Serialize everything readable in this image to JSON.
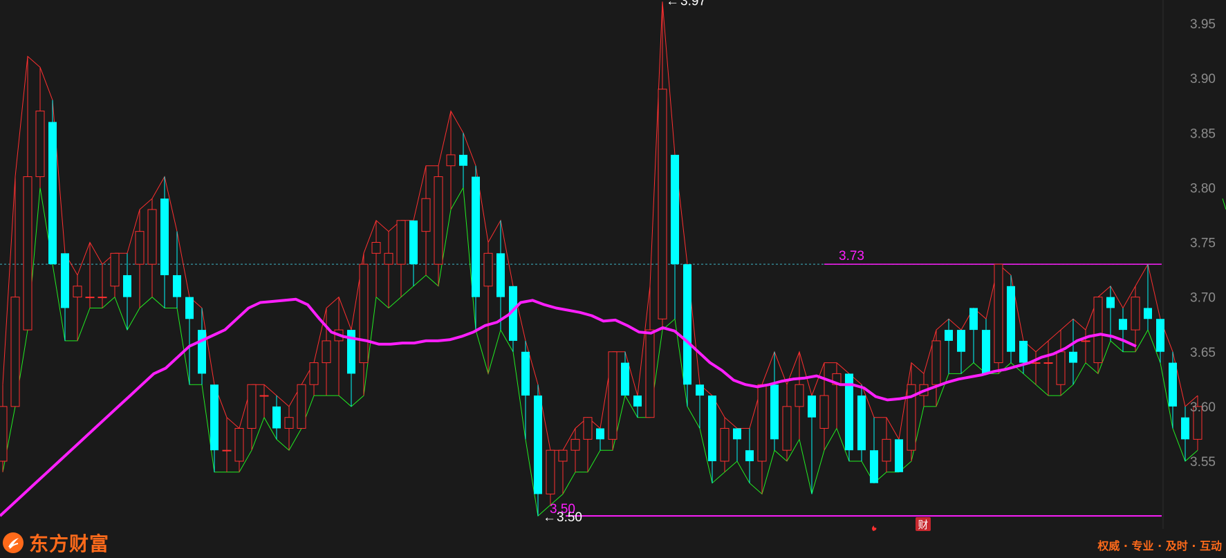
{
  "brand": {
    "name": "东方财富",
    "slogan": "权威 · 专业 · 及时 · 互动"
  },
  "markers": {
    "event_badge": "财",
    "event_icon": "flame-icon"
  },
  "colors": {
    "background": "#1a1a1a",
    "up": "#ff3030",
    "down": "#00ffff",
    "ma": "#ff1fff",
    "lower_band": "#22ee22",
    "reference_line": "#ff1fff",
    "brand": "#ff6a1a",
    "axis_text": "#8c8c8c"
  },
  "chart_data": {
    "type": "candlestick",
    "yaxis": {
      "ticks": [
        "3.95",
        "3.90",
        "3.85",
        "3.80",
        "3.75",
        "3.70",
        "3.65",
        "3.60",
        "3.55"
      ],
      "tick_values": [
        3.95,
        3.9,
        3.85,
        3.8,
        3.75,
        3.7,
        3.65,
        3.6,
        3.55
      ],
      "range": [
        3.495,
        3.985
      ],
      "position": "right"
    },
    "annotations": {
      "high_label": "3.97",
      "high_value": 3.97,
      "low_label": "3.50",
      "low_value": 3.5,
      "level_high_label": "3.73",
      "level_high_value": 3.73,
      "level_low_label": "3.50"
    },
    "candles": [
      [
        3.55,
        3.6,
        3.54,
        3.62
      ],
      [
        3.6,
        3.7,
        3.6,
        3.81
      ],
      [
        3.67,
        3.81,
        3.67,
        3.92
      ],
      [
        3.81,
        3.87,
        3.8,
        3.91
      ],
      [
        3.86,
        3.73,
        3.73,
        3.88
      ],
      [
        3.74,
        3.69,
        3.66,
        3.74
      ],
      [
        3.7,
        3.71,
        3.66,
        3.72
      ],
      [
        3.7,
        3.7,
        3.69,
        3.75
      ],
      [
        3.7,
        3.7,
        3.69,
        3.73
      ],
      [
        3.71,
        3.74,
        3.7,
        3.74
      ],
      [
        3.72,
        3.7,
        3.67,
        3.74
      ],
      [
        3.73,
        3.76,
        3.69,
        3.78
      ],
      [
        3.73,
        3.78,
        3.7,
        3.79
      ],
      [
        3.79,
        3.72,
        3.69,
        3.81
      ],
      [
        3.72,
        3.7,
        3.69,
        3.76
      ],
      [
        3.7,
        3.68,
        3.62,
        3.7
      ],
      [
        3.67,
        3.63,
        3.62,
        3.69
      ],
      [
        3.62,
        3.56,
        3.54,
        3.62
      ],
      [
        3.56,
        3.56,
        3.54,
        3.59
      ],
      [
        3.55,
        3.58,
        3.54,
        3.58
      ],
      [
        3.58,
        3.62,
        3.56,
        3.62
      ],
      [
        3.61,
        3.61,
        3.59,
        3.62
      ],
      [
        3.6,
        3.58,
        3.57,
        3.61
      ],
      [
        3.58,
        3.59,
        3.56,
        3.6
      ],
      [
        3.58,
        3.62,
        3.58,
        3.62
      ],
      [
        3.62,
        3.64,
        3.61,
        3.64
      ],
      [
        3.64,
        3.66,
        3.61,
        3.69
      ],
      [
        3.66,
        3.67,
        3.61,
        3.7
      ],
      [
        3.67,
        3.63,
        3.6,
        3.67
      ],
      [
        3.64,
        3.73,
        3.61,
        3.74
      ],
      [
        3.74,
        3.75,
        3.7,
        3.77
      ],
      [
        3.73,
        3.74,
        3.69,
        3.76
      ],
      [
        3.73,
        3.77,
        3.7,
        3.77
      ],
      [
        3.77,
        3.73,
        3.71,
        3.77
      ],
      [
        3.76,
        3.79,
        3.72,
        3.82
      ],
      [
        3.73,
        3.81,
        3.71,
        3.82
      ],
      [
        3.82,
        3.83,
        3.78,
        3.87
      ],
      [
        3.83,
        3.82,
        3.8,
        3.85
      ],
      [
        3.81,
        3.7,
        3.67,
        3.82
      ],
      [
        3.71,
        3.74,
        3.63,
        3.75
      ],
      [
        3.74,
        3.7,
        3.67,
        3.77
      ],
      [
        3.71,
        3.66,
        3.65,
        3.71
      ],
      [
        3.65,
        3.61,
        3.57,
        3.66
      ],
      [
        3.61,
        3.52,
        3.5,
        3.62
      ],
      [
        3.52,
        3.56,
        3.51,
        3.56
      ],
      [
        3.55,
        3.56,
        3.52,
        3.56
      ],
      [
        3.56,
        3.57,
        3.54,
        3.58
      ],
      [
        3.57,
        3.59,
        3.54,
        3.59
      ],
      [
        3.58,
        3.57,
        3.56,
        3.58
      ],
      [
        3.57,
        3.65,
        3.56,
        3.65
      ],
      [
        3.64,
        3.61,
        3.61,
        3.65
      ],
      [
        3.61,
        3.6,
        3.59,
        3.61
      ],
      [
        3.59,
        3.67,
        3.59,
        3.71
      ],
      [
        3.68,
        3.89,
        3.67,
        3.97
      ],
      [
        3.83,
        3.73,
        3.68,
        3.83
      ],
      [
        3.73,
        3.62,
        3.6,
        3.73
      ],
      [
        3.62,
        3.61,
        3.58,
        3.62
      ],
      [
        3.61,
        3.55,
        3.53,
        3.61
      ],
      [
        3.55,
        3.58,
        3.54,
        3.59
      ],
      [
        3.58,
        3.57,
        3.55,
        3.58
      ],
      [
        3.56,
        3.55,
        3.53,
        3.58
      ],
      [
        3.55,
        3.62,
        3.52,
        3.62
      ],
      [
        3.62,
        3.57,
        3.56,
        3.65
      ],
      [
        3.56,
        3.6,
        3.55,
        3.62
      ],
      [
        3.6,
        3.62,
        3.57,
        3.65
      ],
      [
        3.61,
        3.59,
        3.52,
        3.61
      ],
      [
        3.58,
        3.61,
        3.56,
        3.64
      ],
      [
        3.62,
        3.63,
        3.58,
        3.64
      ],
      [
        3.63,
        3.56,
        3.55,
        3.63
      ],
      [
        3.61,
        3.56,
        3.55,
        3.62
      ],
      [
        3.56,
        3.53,
        3.53,
        3.59
      ],
      [
        3.55,
        3.57,
        3.54,
        3.59
      ],
      [
        3.57,
        3.54,
        3.54,
        3.57
      ],
      [
        3.56,
        3.62,
        3.55,
        3.64
      ],
      [
        3.61,
        3.62,
        3.6,
        3.63
      ],
      [
        3.62,
        3.66,
        3.6,
        3.67
      ],
      [
        3.67,
        3.66,
        3.63,
        3.68
      ],
      [
        3.67,
        3.65,
        3.63,
        3.67
      ],
      [
        3.69,
        3.67,
        3.64,
        3.69
      ],
      [
        3.67,
        3.63,
        3.63,
        3.68
      ],
      [
        3.64,
        3.73,
        3.63,
        3.73
      ],
      [
        3.71,
        3.65,
        3.64,
        3.72
      ],
      [
        3.66,
        3.64,
        3.63,
        3.66
      ],
      [
        3.64,
        3.64,
        3.62,
        3.65
      ],
      [
        3.64,
        3.64,
        3.61,
        3.66
      ],
      [
        3.62,
        3.65,
        3.61,
        3.67
      ],
      [
        3.65,
        3.64,
        3.62,
        3.68
      ],
      [
        3.66,
        3.66,
        3.64,
        3.67
      ],
      [
        3.64,
        3.7,
        3.63,
        3.7
      ],
      [
        3.7,
        3.69,
        3.66,
        3.71
      ],
      [
        3.68,
        3.67,
        3.65,
        3.69
      ],
      [
        3.67,
        3.7,
        3.65,
        3.71
      ],
      [
        3.69,
        3.68,
        3.67,
        3.73
      ],
      [
        3.68,
        3.65,
        3.64,
        3.68
      ],
      [
        3.64,
        3.6,
        3.58,
        3.65
      ],
      [
        3.59,
        3.57,
        3.55,
        3.6
      ],
      [
        3.57,
        3.6,
        3.56,
        3.61
      ]
    ],
    "ma": [
      3.5,
      3.51,
      3.52,
      3.53,
      3.54,
      3.55,
      3.56,
      3.57,
      3.58,
      3.59,
      3.6,
      3.61,
      3.62,
      3.63,
      3.635,
      3.645,
      3.655,
      3.66,
      3.665,
      3.67,
      3.68,
      3.69,
      3.695,
      3.696,
      3.697,
      3.698,
      3.693,
      3.68,
      3.668,
      3.664,
      3.662,
      3.66,
      3.657,
      3.657,
      3.658,
      3.658,
      3.66,
      3.66,
      3.661,
      3.664,
      3.668,
      3.674,
      3.677,
      3.684,
      3.695,
      3.697,
      3.693,
      3.69,
      3.688,
      3.686,
      3.683,
      3.678,
      3.679,
      3.674,
      3.668,
      3.667,
      3.672,
      3.669,
      3.66,
      3.65,
      3.64,
      3.633,
      3.624,
      3.62,
      3.618,
      3.62,
      3.623,
      3.625,
      3.626,
      3.628,
      3.624,
      3.62,
      3.62,
      3.617,
      3.609,
      3.606,
      3.607,
      3.609,
      3.614,
      3.618,
      3.622,
      3.625,
      3.627,
      3.629,
      3.632,
      3.634,
      3.637,
      3.64,
      3.645,
      3.648,
      3.653,
      3.66,
      3.664,
      3.666,
      3.664,
      3.66,
      3.655
    ]
  }
}
